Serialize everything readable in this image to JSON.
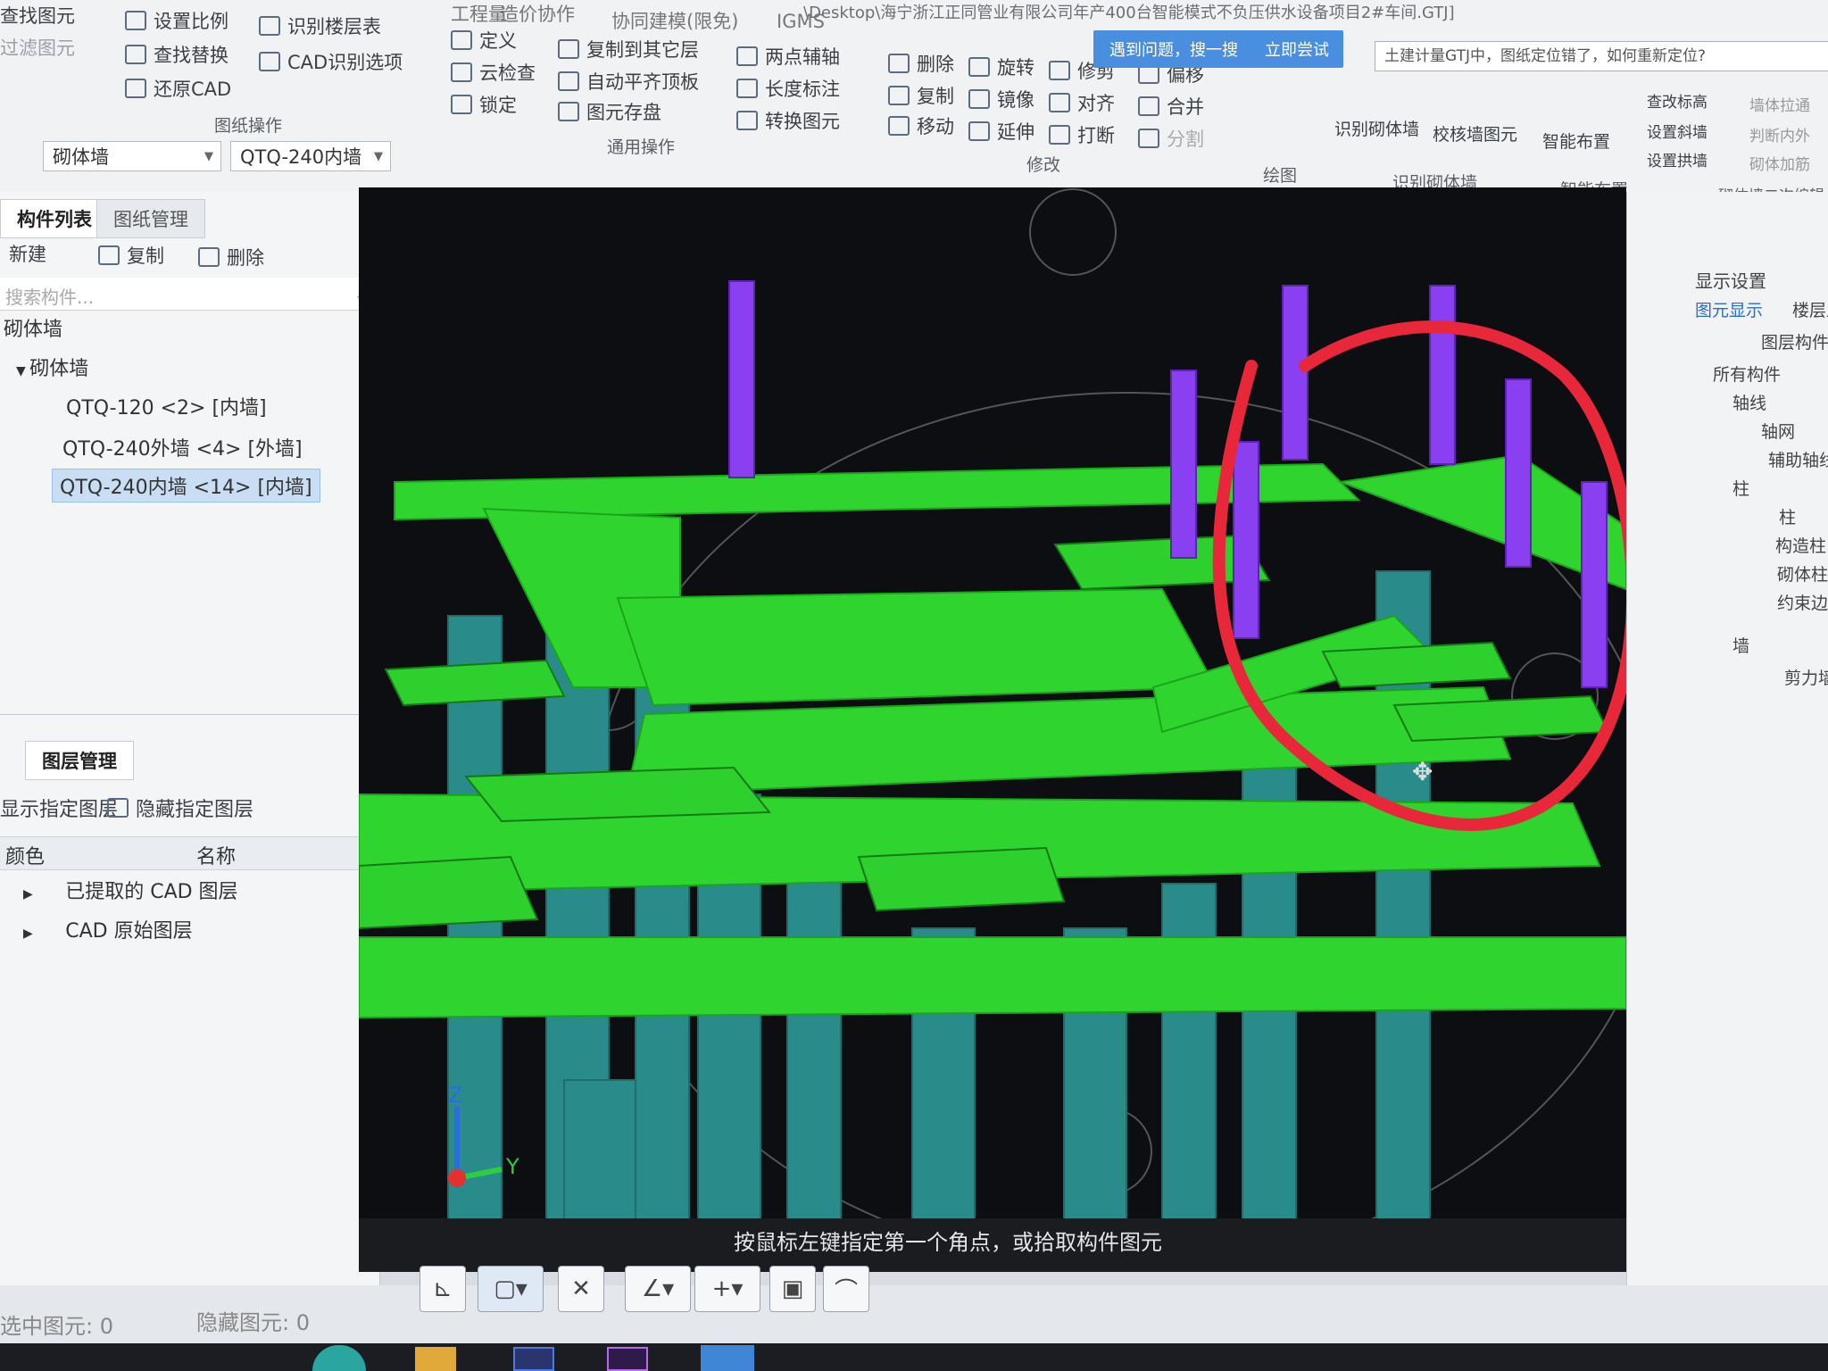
{
  "title_path": "\\Desktop\\海宁浙江正同管业有限公司年产400台智能模式不负压供水设备项目2#车间.GTJ]",
  "ribbon": {
    "tabs_top": [
      "工程量",
      "造价协作",
      "协同建模(限免)",
      "IGMS"
    ],
    "col1": [
      "查找图元",
      "过滤图元"
    ],
    "col2": [
      "设置比例",
      "查找替换",
      "还原CAD"
    ],
    "col3": [
      "识别楼层表",
      "CAD识别选项"
    ],
    "group_drawing_ops": "图纸操作",
    "col4": [
      "定义",
      "云检查",
      "锁定"
    ],
    "col5": [
      "复制到其它层",
      "自动平齐顶板",
      "图元存盘"
    ],
    "col6": [
      "两点辅轴",
      "长度标注",
      "转换图元"
    ],
    "group_common_ops": "通用操作",
    "col7": [
      "删除",
      "复制",
      "移动"
    ],
    "col8": [
      "旋转",
      "镜像",
      "延伸"
    ],
    "col9": [
      "修剪",
      "对齐",
      "打断"
    ],
    "col10": [
      "偏移",
      "合并",
      "分割"
    ],
    "group_modify": "修改",
    "group_draw": "绘图",
    "identify_buttons": [
      "识别砌体墙",
      "校核墙图元"
    ],
    "group_identify": "识别砌体墙",
    "smart_layout": "智能布置",
    "group_smart": "智能布置",
    "col_right": [
      "查改标高",
      "设置斜墙",
      "设置拱墙"
    ],
    "col_right2": [
      "墙体拉通",
      "判断内外",
      "砌体加筋"
    ],
    "group_secondary": "砌体墙二次编辑",
    "notice": {
      "text": "遇到问题，搜一搜",
      "action": "立即尝试"
    },
    "hint": "土建计量GTJ中，图纸定位错了，如何重新定位?"
  },
  "selectors": {
    "category": "砌体墙",
    "component": "QTQ-240内墙"
  },
  "left_panel": {
    "tabs": [
      "构件列表",
      "图纸管理"
    ],
    "toolbar": [
      "新建",
      "复制",
      "删除"
    ],
    "search_placeholder": "搜索构件...",
    "tree_root": "砌体墙",
    "tree_group": "砌体墙",
    "items": [
      "QTQ-120 <2> [内墙]",
      "QTQ-240外墙 <4> [外墙]",
      "QTQ-240内墙 <14> [内墙]"
    ],
    "layer_tabs": [
      "图层管理"
    ],
    "layer_toolbar": [
      "显示指定图层",
      "隐藏指定图层"
    ],
    "layer_headers": [
      "颜色",
      "名称"
    ],
    "layers": [
      "已提取的 CAD 图层",
      "CAD 原始图层"
    ]
  },
  "viewport": {
    "command_prompt": "按鼠标左键指定第一个角点，或拾取构件图元",
    "axis_z": "Z",
    "axis_y": "Y"
  },
  "right_panel": {
    "title": "显示设置",
    "tabs": [
      "图元显示",
      "楼层显示"
    ],
    "header": "图层构件",
    "items": [
      "所有构件",
      "轴线",
      "轴网",
      "辅助轴线",
      "柱",
      "柱",
      "构造柱",
      "砌体柱",
      "约束边缘",
      "墙",
      "剪力墙"
    ]
  },
  "status": {
    "selected_label": "选中图元: 0",
    "hidden_label": "隐藏图元: 0"
  },
  "colors": {
    "beam": "#2fd42f",
    "column": "#2a8c8a",
    "wall": "#8a3ff0",
    "markup": "#e8283a"
  }
}
